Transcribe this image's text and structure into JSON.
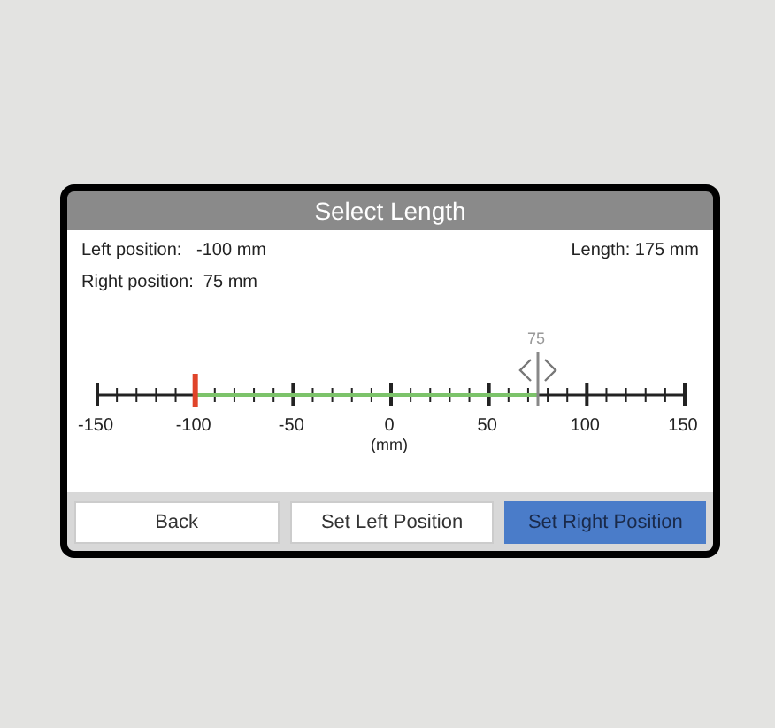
{
  "window": {
    "title": "Select Length"
  },
  "info": {
    "left_position": "Left position:   -100 mm",
    "right_position": "Right position:  75 mm",
    "length": "Length: 175 mm"
  },
  "ruler": {
    "left_marker": {
      "level": 0.1667
    },
    "right_marker": {
      "level": 0.75,
      "label": "75"
    },
    "unit": "(mm)",
    "tick_labels": [
      "-150",
      "-100",
      "-50",
      "0",
      "50",
      "100",
      "150"
    ]
  },
  "buttons": [
    {
      "label": "Back",
      "selected": false
    },
    {
      "label": "Set Left Position",
      "selected": false
    },
    {
      "label": "Set Right Position",
      "selected": true
    }
  ]
}
